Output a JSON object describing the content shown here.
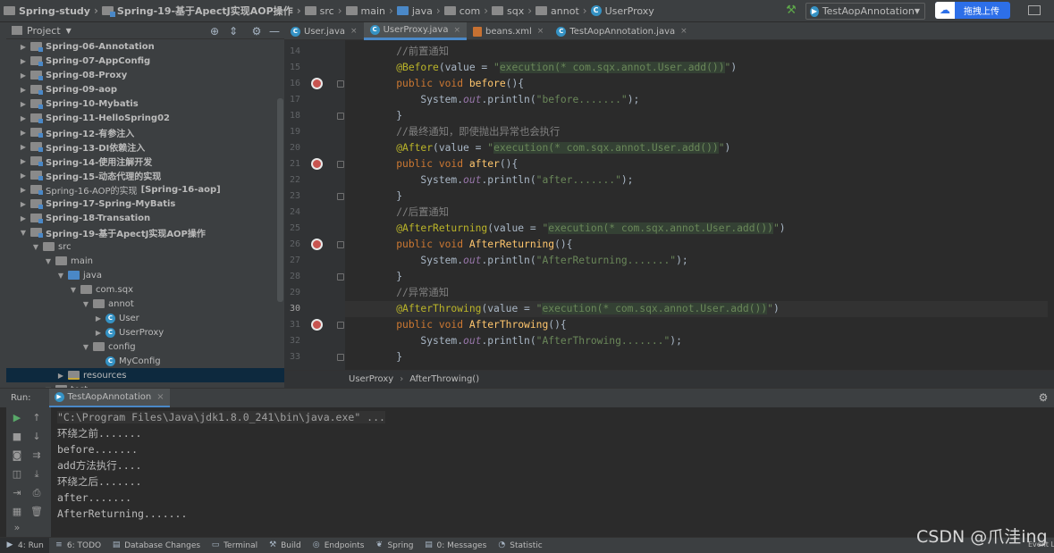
{
  "navbar": {
    "crumbs": [
      "Spring-study",
      "Spring-19-基于ApectJ实现AOP操作",
      "src",
      "main",
      "java",
      "com",
      "sqx",
      "annot",
      "UserProxy"
    ],
    "run_config": "TestAopAnnotation",
    "upload_label": "拖拽上传"
  },
  "project": {
    "title": "Project",
    "tree": [
      {
        "label": "Spring-06-Annotation",
        "depth": 0,
        "type": "module",
        "arrow": "▶"
      },
      {
        "label": "Spring-07-AppConfig",
        "depth": 0,
        "type": "module",
        "arrow": "▶"
      },
      {
        "label": "Spring-08-Proxy",
        "depth": 0,
        "type": "module",
        "arrow": "▶"
      },
      {
        "label": "Spring-09-aop",
        "depth": 0,
        "type": "module",
        "arrow": "▶"
      },
      {
        "label": "Spring-10-Mybatis",
        "depth": 0,
        "type": "module",
        "arrow": "▶"
      },
      {
        "label": "Spring-11-HelloSpring02",
        "depth": 0,
        "type": "module",
        "arrow": "▶"
      },
      {
        "label": "Spring-12-有参注入",
        "depth": 0,
        "type": "module",
        "arrow": "▶"
      },
      {
        "label": "Spring-13-DI依赖注入",
        "depth": 0,
        "type": "module",
        "arrow": "▶"
      },
      {
        "label": "Spring-14-使用注解开发",
        "depth": 0,
        "type": "module",
        "arrow": "▶"
      },
      {
        "label": "Spring-15-动态代理的实现",
        "depth": 0,
        "type": "module",
        "arrow": "▶"
      },
      {
        "label": "Spring-16-AOP的实现",
        "suffix": "[Spring-16-aop]",
        "depth": 0,
        "type": "module",
        "arrow": "▶",
        "normal": true
      },
      {
        "label": "Spring-17-Spring-MyBatis",
        "depth": 0,
        "type": "module",
        "arrow": "▶"
      },
      {
        "label": "Spring-18-Transation",
        "depth": 0,
        "type": "module",
        "arrow": "▶"
      },
      {
        "label": "Spring-19-基于ApectJ实现AOP操作",
        "depth": 0,
        "type": "module",
        "arrow": "▼"
      },
      {
        "label": "src",
        "depth": 1,
        "type": "folder",
        "arrow": "▼"
      },
      {
        "label": "main",
        "depth": 2,
        "type": "folder",
        "arrow": "▼"
      },
      {
        "label": "java",
        "depth": 3,
        "type": "src",
        "arrow": "▼"
      },
      {
        "label": "com.sqx",
        "depth": 4,
        "type": "folder",
        "arrow": "▼"
      },
      {
        "label": "annot",
        "depth": 5,
        "type": "folder",
        "arrow": "▼"
      },
      {
        "label": "User",
        "depth": 6,
        "type": "class",
        "arrow": "▶"
      },
      {
        "label": "UserProxy",
        "depth": 6,
        "type": "class",
        "arrow": "▶"
      },
      {
        "label": "config",
        "depth": 5,
        "type": "folder",
        "arrow": "▼"
      },
      {
        "label": "MyConfig",
        "depth": 6,
        "type": "class",
        "arrow": ""
      },
      {
        "label": "resources",
        "depth": 3,
        "type": "res",
        "arrow": "▶",
        "selected": true
      },
      {
        "label": "test",
        "depth": 2,
        "type": "folder",
        "arrow": "▼"
      }
    ]
  },
  "editor": {
    "tabs": [
      {
        "label": "User.java",
        "icon": "class-icon",
        "active": false
      },
      {
        "label": "UserProxy.java",
        "icon": "class-icon",
        "active": true
      },
      {
        "label": "beans.xml",
        "icon": "xml-icon",
        "active": false
      },
      {
        "label": "TestAopAnnotation.java",
        "icon": "class-icon",
        "active": false
      }
    ],
    "lines": [
      {
        "n": "14",
        "text": "    //前置通知"
      },
      {
        "n": "15",
        "text": "    @Before(value = \"execution(* com.sqx.annot.User.add())\")"
      },
      {
        "n": "16",
        "text": "    public void before(){"
      },
      {
        "n": "17",
        "text": "        System.out.println(\"before.......\");"
      },
      {
        "n": "18",
        "text": "    }"
      },
      {
        "n": "19",
        "text": "    //最终通知，即使抛出异常也会执行"
      },
      {
        "n": "20",
        "text": "    @After(value = \"execution(* com.sqx.annot.User.add())\")"
      },
      {
        "n": "21",
        "text": "    public void after(){"
      },
      {
        "n": "22",
        "text": "        System.out.println(\"after.......\");"
      },
      {
        "n": "23",
        "text": "    }"
      },
      {
        "n": "24",
        "text": "    //后置通知"
      },
      {
        "n": "25",
        "text": "    @AfterReturning(value = \"execution(* com.sqx.annot.User.add())\")"
      },
      {
        "n": "26",
        "text": "    public void AfterReturning(){"
      },
      {
        "n": "27",
        "text": "        System.out.println(\"AfterReturning.......\");"
      },
      {
        "n": "28",
        "text": "    }"
      },
      {
        "n": "29",
        "text": "    //异常通知"
      },
      {
        "n": "30",
        "text": "    @AfterThrowing(value = \"execution(* com.sqx.annot.User.add())\")"
      },
      {
        "n": "31",
        "text": "    public void AfterThrowing(){"
      },
      {
        "n": "32",
        "text": "        System.out.println(\"AfterThrowing.......\");"
      },
      {
        "n": "33",
        "text": "    }"
      }
    ],
    "breadcrumb": [
      "UserProxy",
      "AfterThrowing()"
    ]
  },
  "run": {
    "label": "Run:",
    "tab": "TestAopAnnotation",
    "console": [
      "\"C:\\Program Files\\Java\\jdk1.8.0_241\\bin\\java.exe\" ...",
      "环绕之前.......",
      "before.......",
      "add方法执行....",
      "环绕之后.......",
      "after.......",
      "AfterReturning......."
    ]
  },
  "bottombar": {
    "tabs": [
      {
        "label": "4: Run",
        "icon": "▶"
      },
      {
        "label": "6: TODO",
        "icon": "≡"
      },
      {
        "label": "Database Changes",
        "icon": "▤"
      },
      {
        "label": "Terminal",
        "icon": "▭"
      },
      {
        "label": "Build",
        "icon": "⚒"
      },
      {
        "label": "Endpoints",
        "icon": "◎"
      },
      {
        "label": "Spring",
        "icon": "❦"
      },
      {
        "label": "0: Messages",
        "icon": "▤"
      },
      {
        "label": "Statistic",
        "icon": "◔"
      }
    ],
    "event_log": "Event L"
  },
  "watermark": "CSDN @爪洼ing"
}
